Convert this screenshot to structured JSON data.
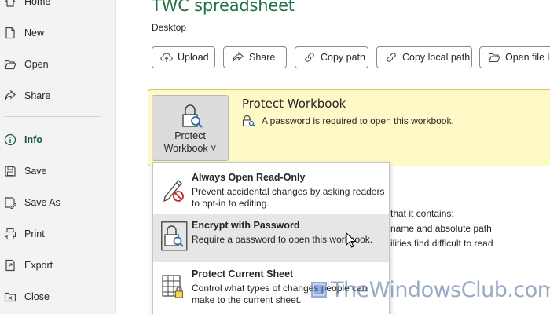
{
  "sidebar": {
    "items": [
      {
        "label": "Home",
        "icon": "home-icon"
      },
      {
        "label": "New",
        "icon": "new-document-icon"
      },
      {
        "label": "Open",
        "icon": "open-folder-icon"
      },
      {
        "label": "Share",
        "icon": "share-icon"
      },
      {
        "label": "Info",
        "icon": "info-icon",
        "active": true
      },
      {
        "label": "Save",
        "icon": "save-icon"
      },
      {
        "label": "Save As",
        "icon": "save-as-icon"
      },
      {
        "label": "Print",
        "icon": "print-icon"
      },
      {
        "label": "Export",
        "icon": "export-icon"
      },
      {
        "label": "Close",
        "icon": "close-folder-icon"
      }
    ]
  },
  "header": {
    "title": "TWC spreadsheet",
    "location": "Desktop"
  },
  "toolbar": {
    "upload": "Upload",
    "share": "Share",
    "copy_path": "Copy path",
    "copy_local_path": "Copy local path",
    "open_file_location": "Open file lo"
  },
  "protect": {
    "button_line1": "Protect",
    "button_line2": "Workbook ˅",
    "title": "Protect Workbook",
    "note": "A password is required to open this workbook."
  },
  "background_info": {
    "line1": "that it contains:",
    "line2": "name and absolute path",
    "line3": "ilities find difficult to read"
  },
  "menu": {
    "items": [
      {
        "title": "Always Open Read-Only",
        "desc": "Prevent accidental changes by asking readers to opt-in to editing."
      },
      {
        "title": "Encrypt with Password",
        "desc": "Require a password to open this workbook."
      },
      {
        "title": "Protect Current Sheet",
        "desc": "Control what types of changes people can make to the current sheet."
      }
    ]
  },
  "watermark": {
    "text": "TheWindowsClub.com"
  },
  "colors": {
    "accent_green": "#217346",
    "active_nav": "#185c37",
    "panel_yellow": "#fff9c7",
    "hover_gray": "#e6e6e6"
  }
}
